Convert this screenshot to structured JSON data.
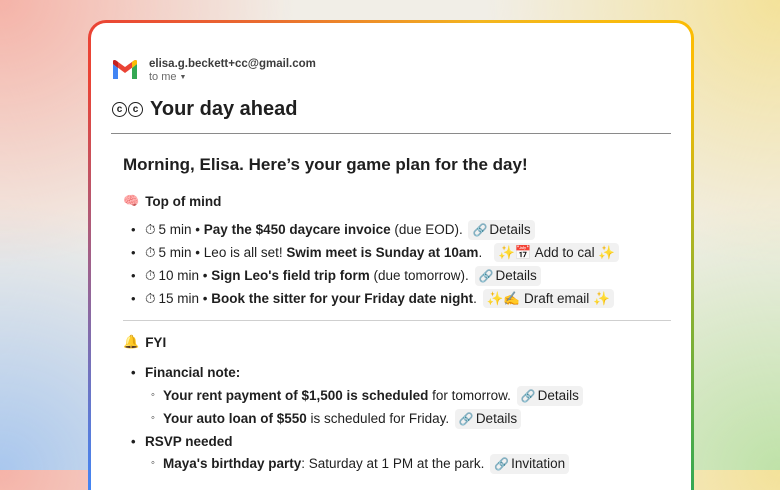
{
  "email": {
    "sender": "elisa.g.beckett+cc@gmail.com",
    "to": "to me",
    "title": "Your day ahead",
    "cc_badge": [
      "c",
      "c"
    ]
  },
  "greeting": "Morning, Elisa. Here’s your game plan for the day!",
  "top_of_mind": {
    "emoji": "🧠",
    "heading": "Top of mind",
    "items": [
      {
        "time": "5 min •",
        "pre": "",
        "bold": "Pay the $450 daycare invoice",
        "post": " (due EOD).",
        "chip": "Details",
        "chip_icon": "link-icon"
      },
      {
        "time": "5 min •",
        "pre": "Leo is all set! ",
        "bold": "Swim meet is Sunday at 10am",
        "post": ".",
        "chip": "✨📅 Add to cal ✨",
        "chip_icon": ""
      },
      {
        "time": "10 min •",
        "pre": "",
        "bold": "Sign Leo's field trip form",
        "post": " (due tomorrow).",
        "chip": "Details",
        "chip_icon": "link-icon"
      },
      {
        "time": "15 min •",
        "pre": "",
        "bold": "Book the sitter for your Friday date night",
        "post": ".",
        "chip": "✨✍️ Draft email ✨",
        "chip_icon": ""
      }
    ]
  },
  "fyi": {
    "emoji": "🔔",
    "heading": "FYI",
    "financial_note": "Financial note:",
    "financial_items": [
      {
        "bold": "Your rent payment of $1,500 is scheduled",
        "post": " for tomorrow.",
        "chip": "Details"
      },
      {
        "bold": "Your auto loan of $550",
        "post": " is scheduled for Friday.",
        "chip": "Details"
      }
    ],
    "rsvp": "RSVP needed",
    "rsvp_items": [
      {
        "bold": "Maya's birthday party",
        "post": ": Saturday at 1 PM at the park.",
        "chip": "Invitation"
      }
    ]
  }
}
